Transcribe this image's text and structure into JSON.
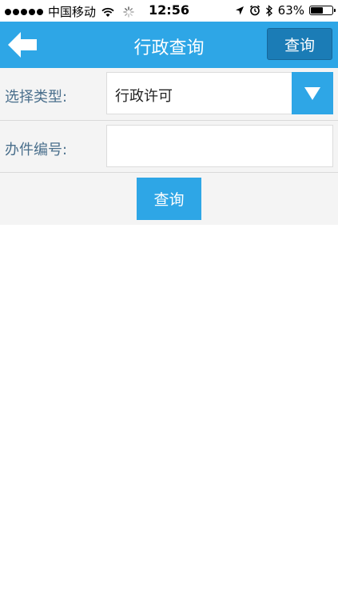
{
  "status_bar": {
    "carrier": "中国移动",
    "time": "12:56",
    "battery_percent": "63%",
    "battery_level": 0.63
  },
  "nav": {
    "title": "行政查询",
    "query_label": "查询",
    "back_icon": "back-arrow-icon"
  },
  "form": {
    "type_label": "选择类型:",
    "type_value": "行政许可",
    "number_label": "办件编号:",
    "number_value": "",
    "number_placeholder": "",
    "submit_label": "查询"
  },
  "colors": {
    "accent": "#2ea6e6",
    "nav_button": "#1b7cb6",
    "label": "#4a6f8c"
  }
}
